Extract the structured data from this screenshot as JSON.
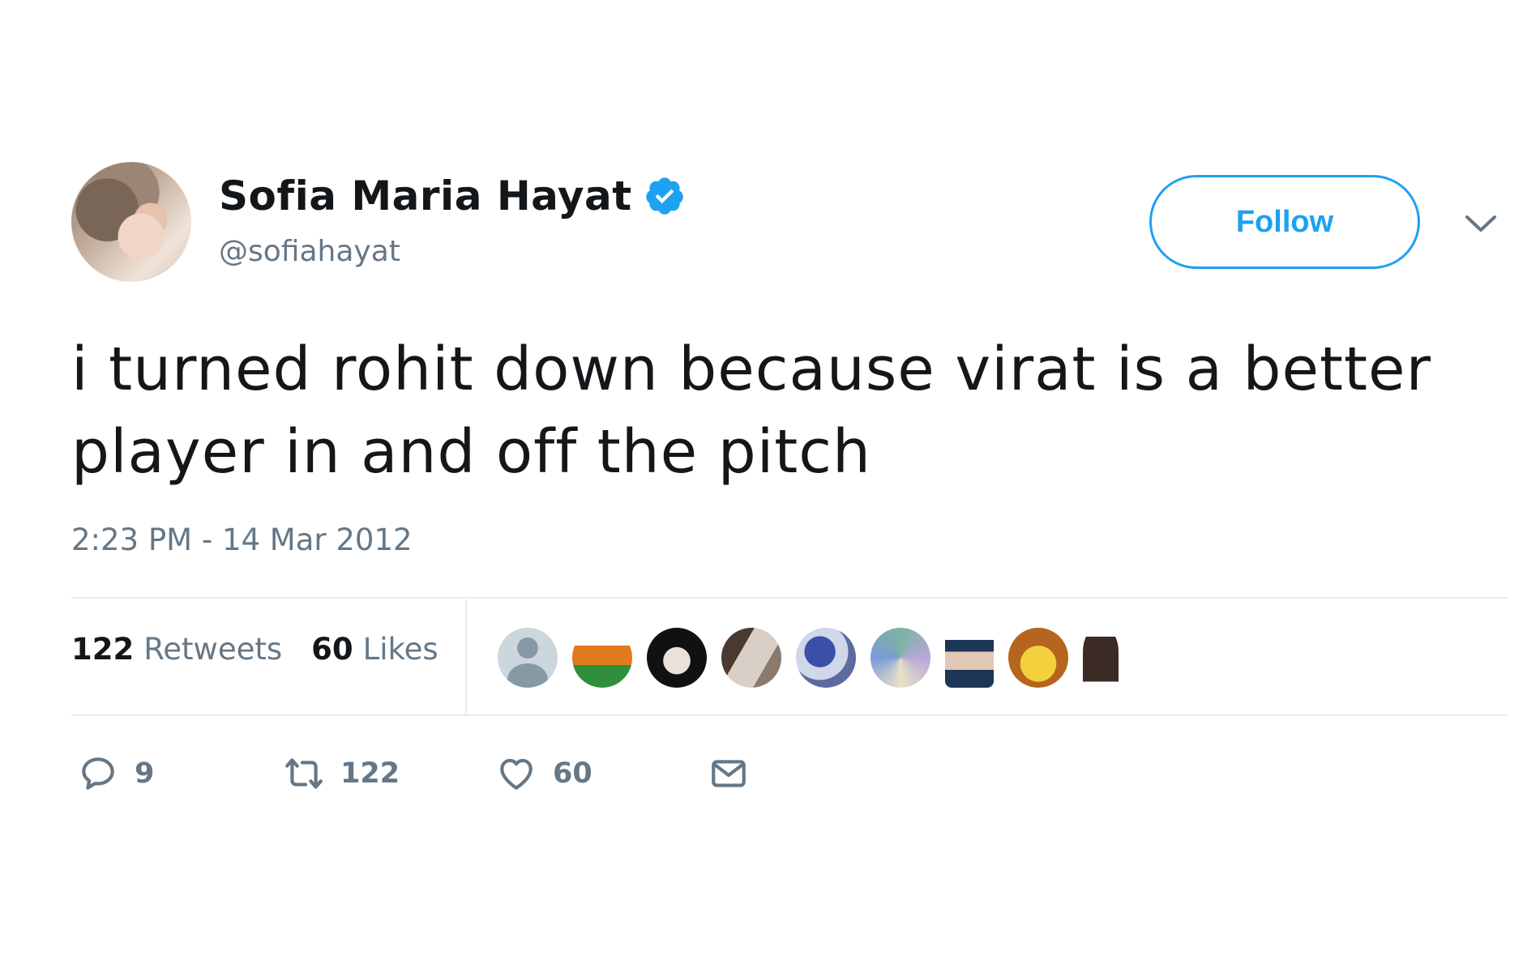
{
  "author": {
    "display_name": "Sofia Maria Hayat",
    "handle": "@sofiahayat",
    "verified": true
  },
  "header": {
    "follow_label": "Follow"
  },
  "tweet": {
    "text": "i turned rohit down because virat is a better player in and off the pitch",
    "timestamp": "2:23 PM - 14 Mar 2012"
  },
  "stats": {
    "retweets_count": "122",
    "retweets_label": "Retweets",
    "likes_count": "60",
    "likes_label": "Likes"
  },
  "actions": {
    "reply_count": "9",
    "retweet_count": "122",
    "like_count": "60"
  },
  "colors": {
    "accent": "#1da1f2",
    "secondary_text": "#657786",
    "primary_text": "#14171a"
  }
}
